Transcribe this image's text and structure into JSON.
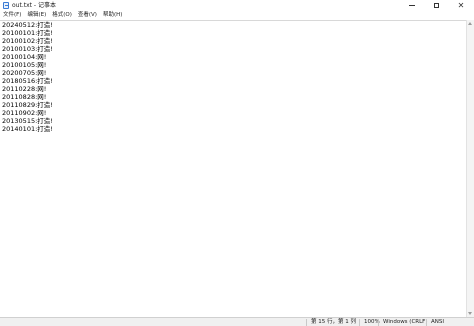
{
  "window": {
    "title": "out.txt - 记事本"
  },
  "menu": [
    "文件(F)",
    "编辑(E)",
    "格式(O)",
    "查看(V)",
    "帮助(H)"
  ],
  "editor": {
    "lines": [
      "20240512:打造!",
      "20100101:打造!",
      "20100102:打造!",
      "20100103:打造!",
      "20100104:网!",
      "20100105:网!",
      "20200705:网!",
      "20180516:打造!",
      "20110228:网!",
      "20110828:网!",
      "20110829:打造!",
      "20110902:网!",
      "20130515:打造!",
      "20140101:打造!"
    ]
  },
  "status": {
    "position": "第 15 行，第 1 列",
    "zoom": "100%",
    "line_ending": "Windows (CRLF)",
    "encoding": "ANSI"
  }
}
